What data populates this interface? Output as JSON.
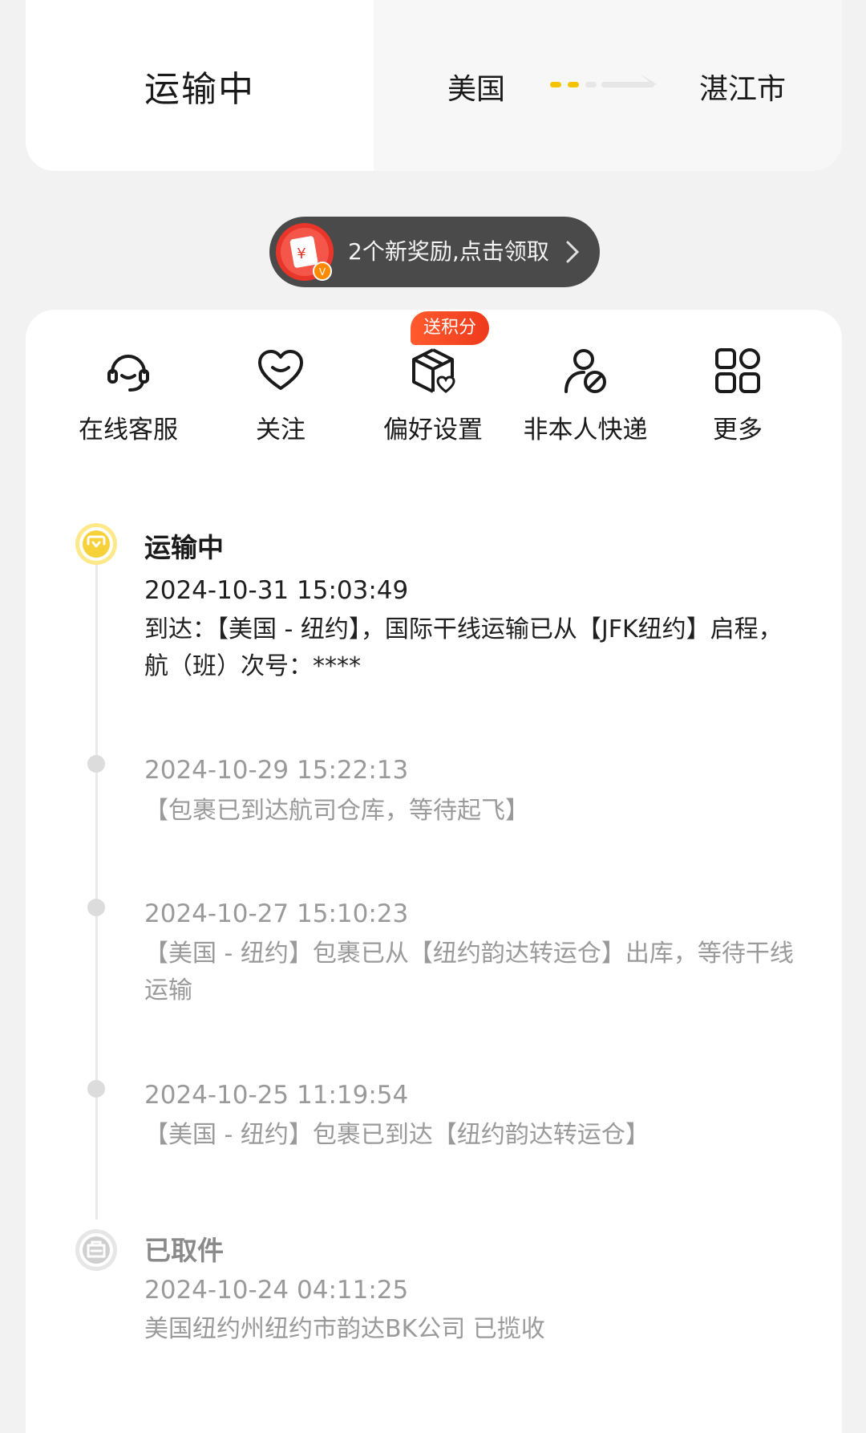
{
  "header": {
    "status_label": "运输中",
    "route_from": "美国",
    "route_to": "湛江市"
  },
  "reward": {
    "text": "2个新奖励,点击领取",
    "icon": "red-envelope-icon"
  },
  "actions": [
    {
      "label": "在线客服",
      "icon": "headset-icon"
    },
    {
      "label": "关注",
      "icon": "heart-icon"
    },
    {
      "label": "偏好设置",
      "icon": "box-heart-icon",
      "badge": "送积分"
    },
    {
      "label": "非本人快递",
      "icon": "user-ban-icon"
    },
    {
      "label": "更多",
      "icon": "grid-icon"
    }
  ],
  "timeline": [
    {
      "status": "运输中",
      "time": "2024-10-31 15:03:49",
      "desc": "到达：【美国 - 纽约】，国际干线运输已从【JFK纽约】启程，航（班）次号：****"
    },
    {
      "time": "2024-10-29 15:22:13",
      "desc": "【包裹已到达航司仓库，等待起飞】"
    },
    {
      "time": "2024-10-27 15:10:23",
      "desc": "【美国 - 纽约】包裹已从【纽约韵达转运仓】出库，等待干线运输"
    },
    {
      "time": "2024-10-25 11:19:54",
      "desc": "【美国 - 纽约】包裹已到达【纽约韵达转运仓】"
    },
    {
      "status": "已取件",
      "time": "2024-10-24 04:11:25",
      "desc": "美国纽约州纽约市韵达BK公司 已揽收"
    }
  ],
  "colors": {
    "accent": "#f5c400",
    "badge": "#ee3a1c",
    "pill": "#4a4a4a"
  }
}
